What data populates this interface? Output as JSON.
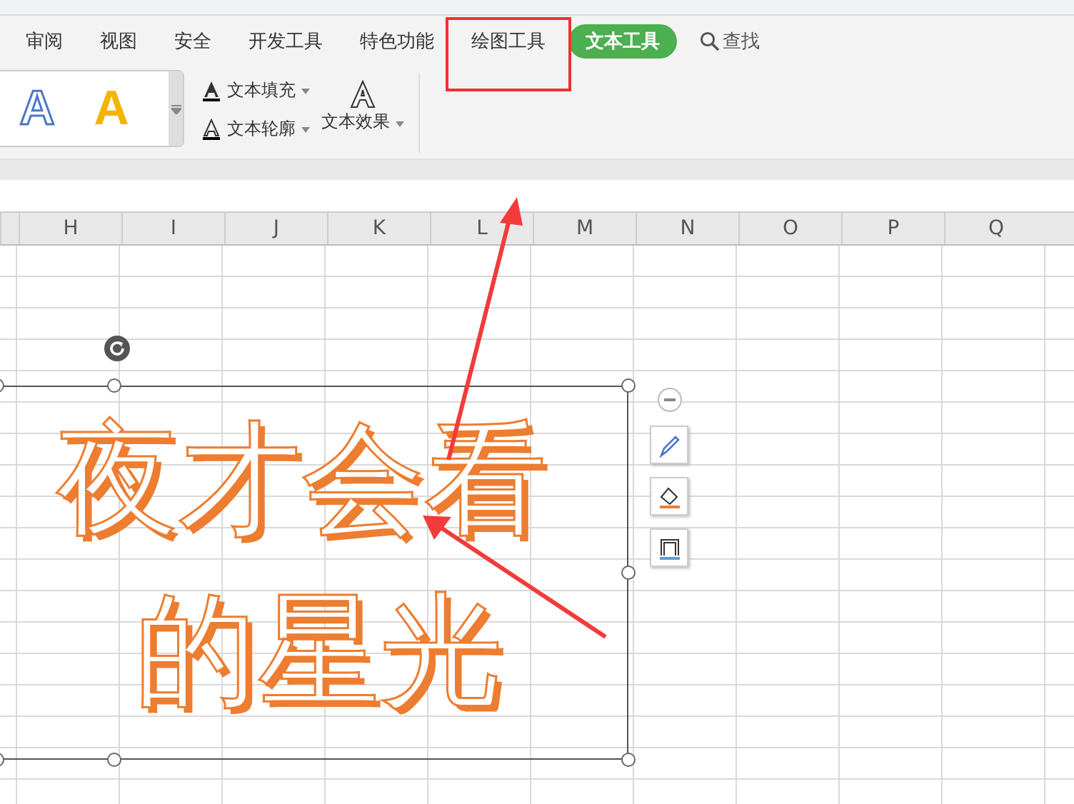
{
  "tabs": [
    {
      "label": "审阅",
      "selected": false
    },
    {
      "label": "视图",
      "selected": false
    },
    {
      "label": "安全",
      "selected": false
    },
    {
      "label": "开发工具",
      "selected": false
    },
    {
      "label": "特色功能",
      "selected": false
    },
    {
      "label": "绘图工具",
      "selected": false,
      "highlighted": true
    },
    {
      "label": "文本工具",
      "selected": true
    }
  ],
  "search": {
    "label": "查找"
  },
  "style_gallery": [
    {
      "label": "A",
      "kind": "outline"
    },
    {
      "label": "A",
      "kind": "solid"
    }
  ],
  "ribbon_buttons": [
    {
      "label": "文本填充",
      "kind": "fill"
    },
    {
      "label": "文本轮廓",
      "kind": "outline"
    }
  ],
  "effects_button": {
    "label": "文本效果"
  },
  "columns": [
    "H",
    "I",
    "J",
    "K",
    "L",
    "M",
    "N",
    "O",
    "P",
    "Q"
  ],
  "text_box": {
    "lines": [
      "夜才会看",
      "的星光"
    ]
  }
}
